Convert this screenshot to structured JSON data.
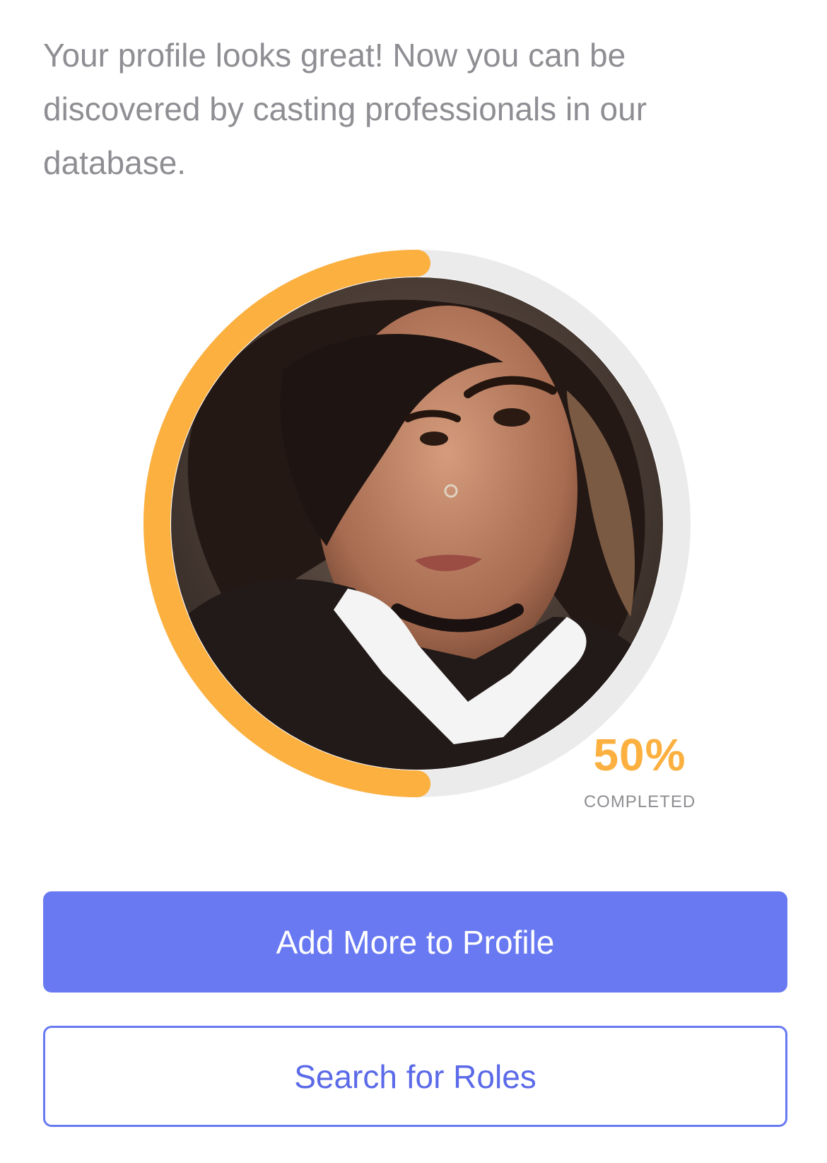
{
  "intro": {
    "text": "Your profile looks great! Now you can be discovered by casting professionals in our database."
  },
  "profile_progress": {
    "value_label": "50%",
    "progress_fraction": 0.5,
    "caption": "COMPLETED",
    "track_color": "#ebebeb",
    "fill_color": "#fbb040"
  },
  "avatar": {
    "icon": "profile-photo"
  },
  "actions": {
    "primary_label": "Add More to Profile",
    "secondary_label": "Search for Roles",
    "accent_color": "#6879f2"
  }
}
